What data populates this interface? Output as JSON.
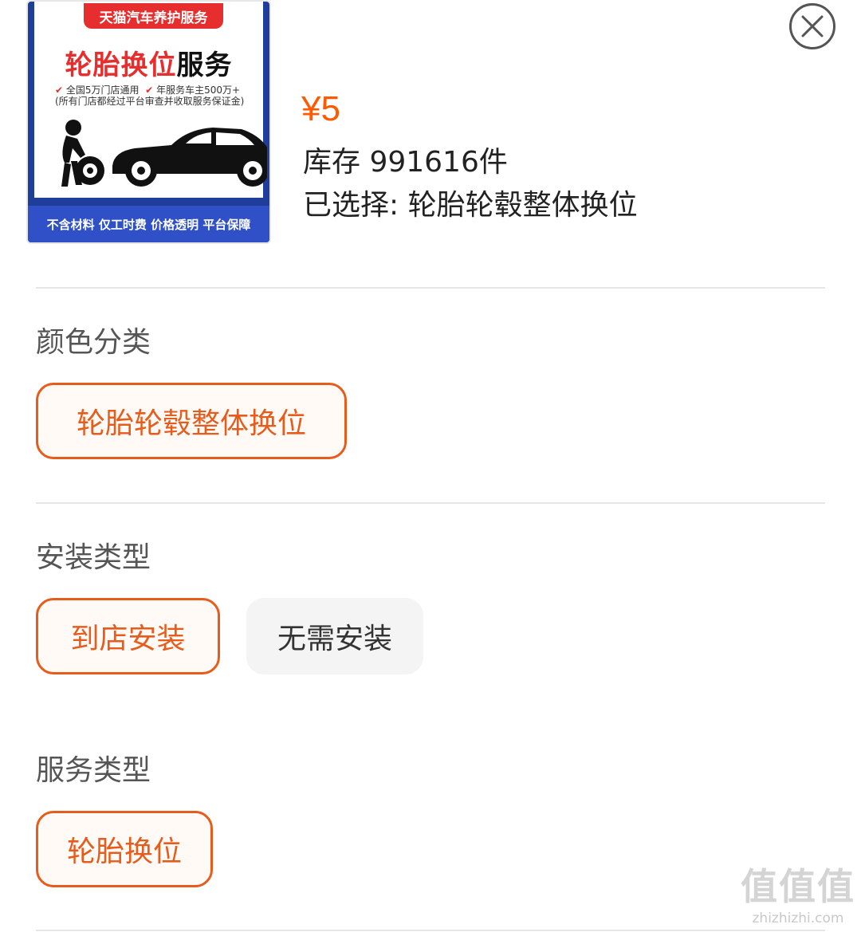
{
  "product": {
    "image": {
      "ribbon": "天猫汽车养护服务",
      "title_red": "轮胎换位",
      "title_black": "服务",
      "point_1": "全国5万门店通用",
      "point_2": "年服务车主500万+",
      "point_note": "(所有门店都经过平台审查并收取服务保证金)",
      "footer": "不含材料 仅工时费 价格透明 平台保障"
    },
    "price": "¥5",
    "stock": "库存 991616件",
    "selected": "已选择: 轮胎轮毂整体换位"
  },
  "close_icon": "close-icon",
  "sections": {
    "color": {
      "title": "颜色分类",
      "options": [
        "轮胎轮毂整体换位"
      ],
      "selected_index": 0
    },
    "install": {
      "title": "安装类型",
      "options": [
        "到店安装",
        "无需安装"
      ],
      "selected_index": 0
    },
    "service": {
      "title": "服务类型",
      "options": [
        "轮胎换位"
      ],
      "selected_index": 0
    }
  },
  "colors": {
    "accent": "#e65c1c",
    "price": "#ff5a00",
    "chip_bg_unselected": "#f4f4f4"
  },
  "watermark": {
    "glyphs": "值值值",
    "domain": "zhizhizhi.com"
  }
}
